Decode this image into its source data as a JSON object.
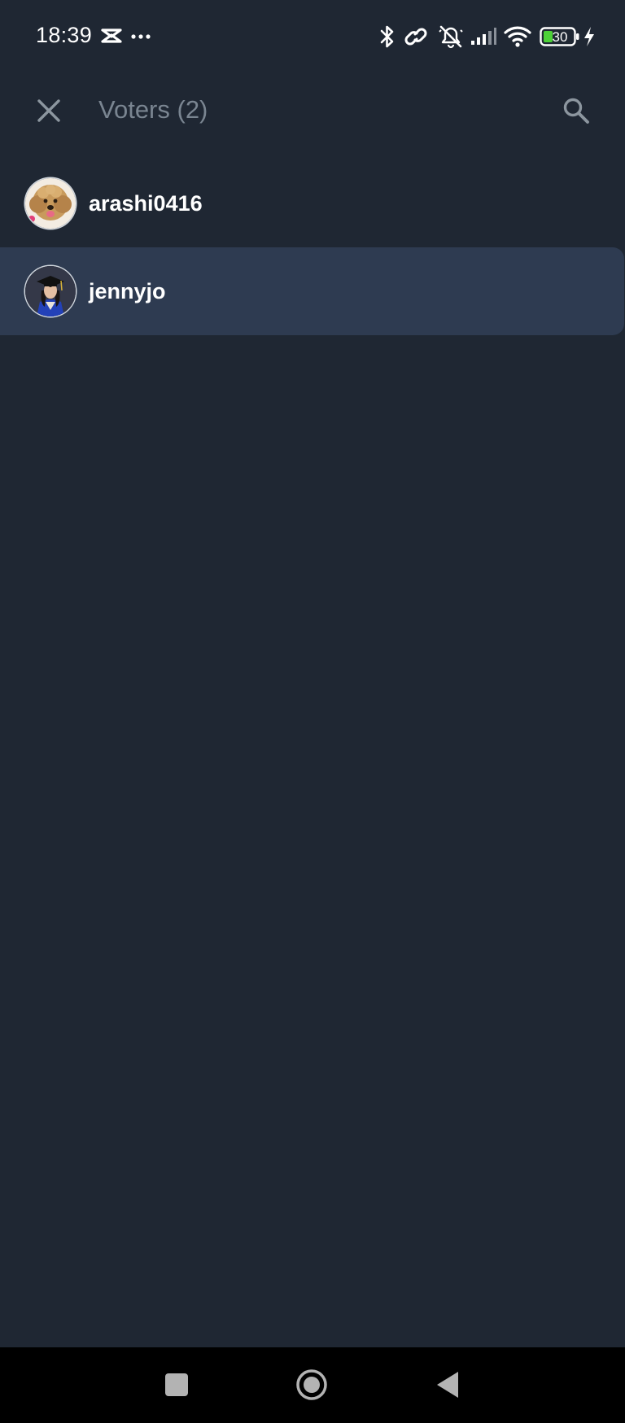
{
  "status_bar": {
    "time": "18:39",
    "battery_level": "30",
    "icons": [
      "capcut-icon",
      "more-dots-icon",
      "bluetooth-icon",
      "link-icon",
      "mute-icon",
      "signal-icon",
      "wifi-icon",
      "battery-icon",
      "charging-icon"
    ]
  },
  "header": {
    "title": "Voters (2)",
    "close_icon": "close-icon",
    "search_icon": "search-icon"
  },
  "voters": [
    {
      "name": "arashi0416",
      "avatar": "dog-avatar",
      "selected": false
    },
    {
      "name": "jennyjo",
      "avatar": "graduate-avatar",
      "selected": true
    }
  ],
  "colors": {
    "background": "#1f2733",
    "selected_row": "#2e3b51",
    "title_muted": "#7a8591",
    "battery_green": "#4cd137"
  },
  "nav_bar": {
    "buttons": [
      "recents-button",
      "home-button",
      "back-button"
    ]
  }
}
